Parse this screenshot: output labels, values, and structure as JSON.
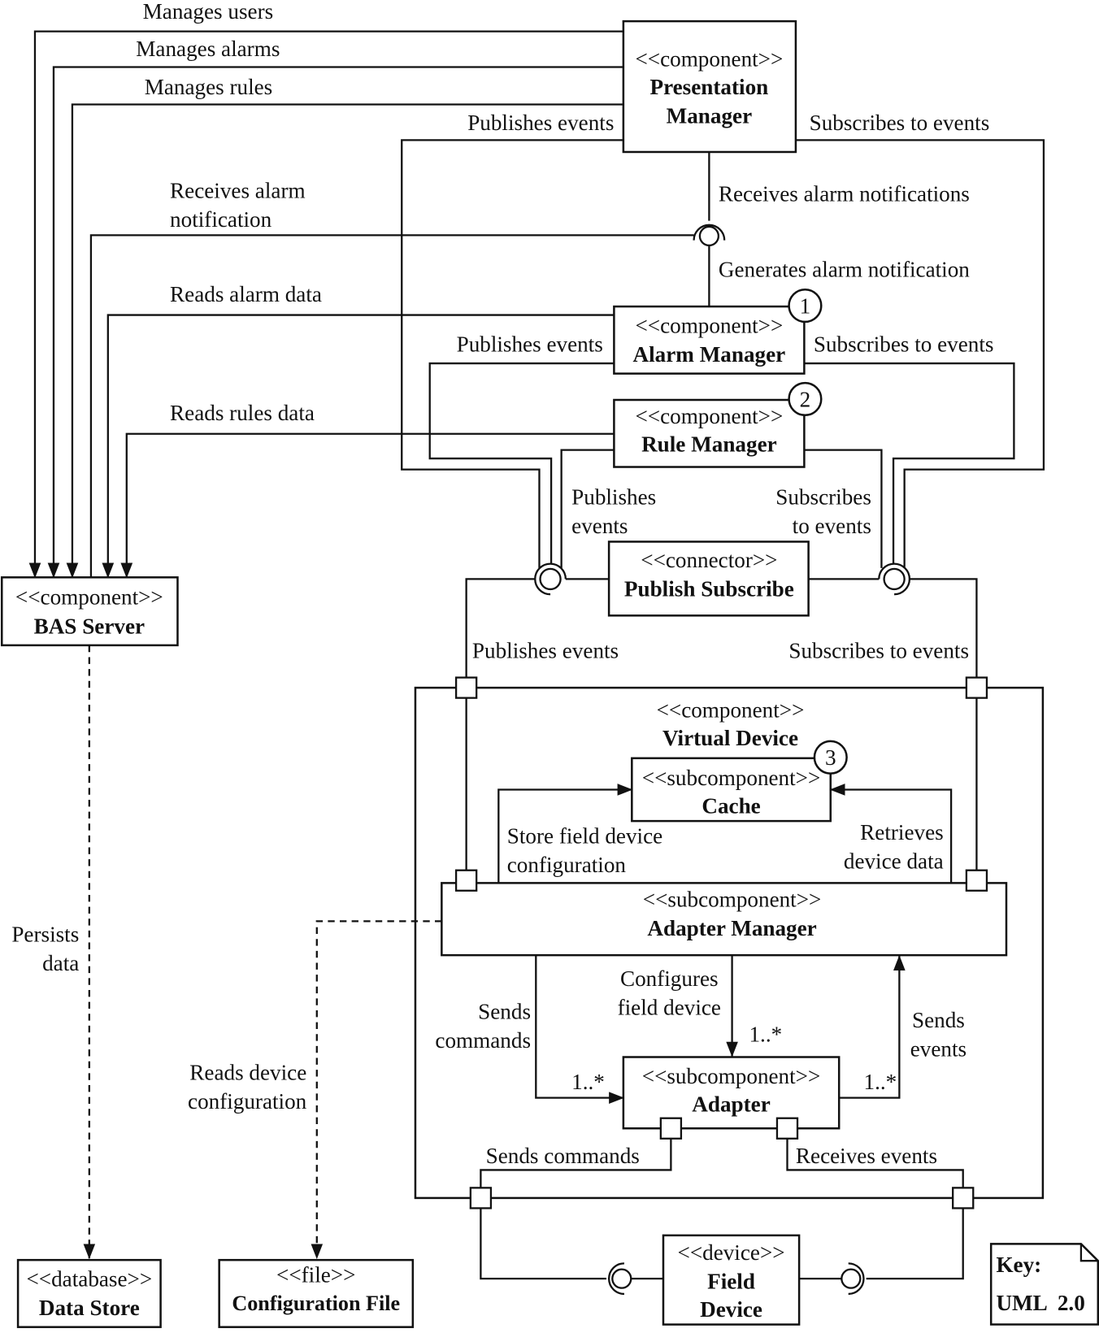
{
  "components": {
    "presentation_manager": {
      "stereotype": "<<component>>",
      "name_line1": "Presentation",
      "name_line2": "Manager"
    },
    "bas_server": {
      "stereotype": "<<component>>",
      "name": "BAS Server"
    },
    "alarm_manager": {
      "stereotype": "<<component>>",
      "name": "Alarm Manager",
      "badge": "1"
    },
    "rule_manager": {
      "stereotype": "<<component>>",
      "name": "Rule Manager",
      "badge": "2"
    },
    "publish_subscribe": {
      "stereotype": "<<connector>>",
      "name": "Publish Subscribe"
    },
    "virtual_device": {
      "stereotype": "<<component>>",
      "name": "Virtual Device"
    },
    "cache": {
      "stereotype": "<<subcomponent>>",
      "name": "Cache",
      "badge": "3"
    },
    "adapter_manager": {
      "stereotype": "<<subcomponent>>",
      "name": "Adapter Manager"
    },
    "adapter": {
      "stereotype": "<<subcomponent>>",
      "name": "Adapter"
    },
    "field_device": {
      "stereotype": "<<device>>",
      "name_line1": "Field",
      "name_line2": "Device"
    },
    "data_store": {
      "stereotype": "<<database>>",
      "name": "Data Store"
    },
    "configuration_file": {
      "stereotype": "<<file>>",
      "name": "Configuration File"
    }
  },
  "labels": {
    "manages_users": "Manages users",
    "manages_alarms": "Manages alarms",
    "manages_rules": "Manages rules",
    "pm_publishes": "Publishes events",
    "pm_subscribes": "Subscribes to events",
    "receives_alarm_1": "Receives alarm",
    "receives_alarm_2": "notification",
    "receives_alarm_notifications": "Receives alarm notifications",
    "generates_alarm_notification": "Generates alarm notification",
    "reads_alarm_data": "Reads alarm data",
    "am_publishes": "Publishes events",
    "am_subscribes": "Subscribes to events",
    "reads_rules_data": "Reads rules data",
    "rm_publishes_1": "Publishes",
    "rm_publishes_2": "events",
    "rm_subscribes_1": "Subscribes",
    "rm_subscribes_2": "to events",
    "vd_publishes": "Publishes events",
    "vd_subscribes": "Subscribes to events",
    "store_config_1": "Store field device",
    "store_config_2": "configuration",
    "retrieves_1": "Retrieves",
    "retrieves_2": "device data",
    "persists_1": "Persists",
    "persists_2": "data",
    "reads_config_1": "Reads device",
    "reads_config_2": "configuration",
    "sends_commands_1": "Sends",
    "sends_commands_2": "commands",
    "configures_1": "Configures",
    "configures_2": "field device",
    "sends_events_1": "Sends",
    "sends_events_2": "events",
    "mult_commands": "1..*",
    "mult_configures": "1..*",
    "mult_events": "1..*",
    "adapter_sends_commands": "Sends commands",
    "adapter_receives_events": "Receives events"
  },
  "key": {
    "title": "Key:",
    "notation": "UML  2.0"
  }
}
